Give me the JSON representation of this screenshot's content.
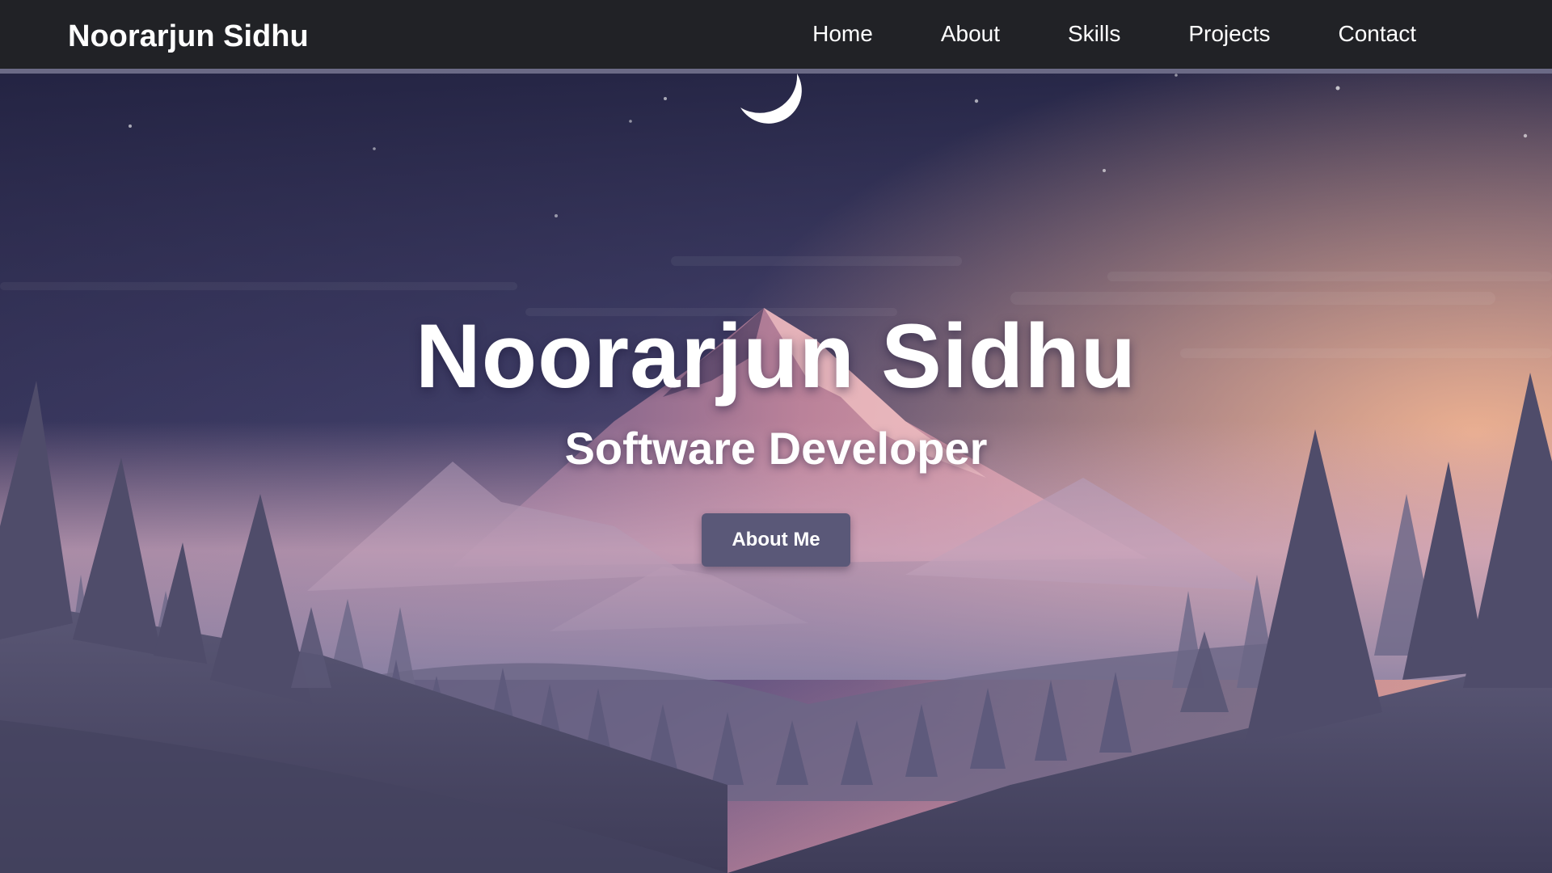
{
  "navbar": {
    "brand": "Noorarjun Sidhu",
    "links": [
      {
        "label": "Home"
      },
      {
        "label": "About"
      },
      {
        "label": "Skills"
      },
      {
        "label": "Projects"
      },
      {
        "label": "Contact"
      }
    ]
  },
  "hero": {
    "title": "Noorarjun Sidhu",
    "subtitle": "Software Developer",
    "button_label": "About Me",
    "background": "night-mountain-landscape"
  },
  "colors": {
    "navbar_bg": "#212226",
    "navbar_border": "#6b6a86",
    "button_bg": "#5a5878",
    "text": "#ffffff",
    "sky_top": "#242443",
    "sky_horizon": "#f3b492"
  }
}
